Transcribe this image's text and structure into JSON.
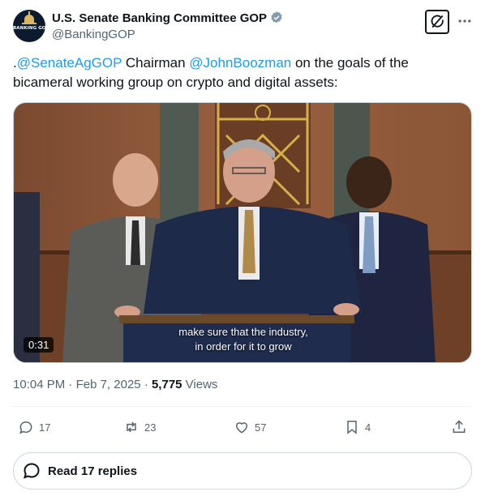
{
  "author": {
    "display_name": "U.S. Senate Banking Committee GOP",
    "handle": "@BankingGOP",
    "avatar_text": "BANKING GOP"
  },
  "icons": {
    "verified": "verified-badge-icon",
    "grok": "grok-icon",
    "more": "more-icon",
    "reply": "reply-icon",
    "retweet": "retweet-icon",
    "like": "like-icon",
    "bookmark": "bookmark-icon",
    "share": "share-icon",
    "replies": "comment-bubble-icon"
  },
  "tweet": {
    "prefix": ".",
    "mention1": "@SenateAgGOP",
    "middle": " Chairman ",
    "mention2": "@JohnBoozman",
    "suffix": " on the goals of the bicameral working group on crypto and digital assets:"
  },
  "video": {
    "duration": "0:31",
    "caption_line1": "make sure that the industry,",
    "caption_line2": "in order for it to grow"
  },
  "meta": {
    "time": "10:04 PM",
    "sep1": " · ",
    "date": "Feb 7, 2025",
    "sep2": " · ",
    "views_count": "5,775",
    "views_label": " Views"
  },
  "actions": {
    "replies": "17",
    "retweets": "23",
    "likes": "57",
    "bookmarks": "4"
  },
  "read_replies_label": "Read 17 replies",
  "colors": {
    "link": "#1d9bf0",
    "text": "#0f1419",
    "secondary": "#536471",
    "border": "#cfd9de"
  }
}
